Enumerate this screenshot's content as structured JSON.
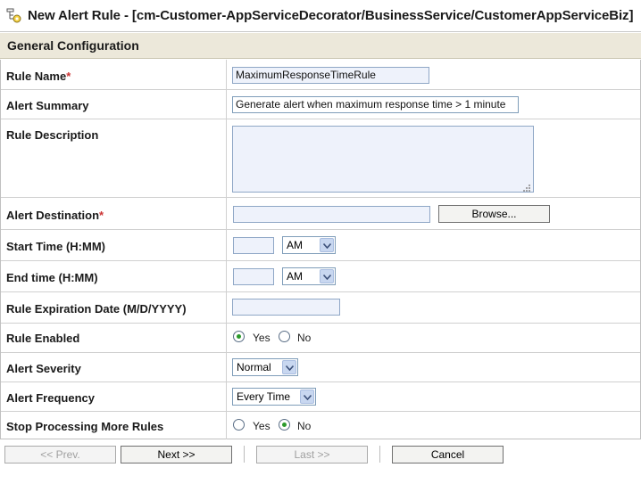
{
  "window": {
    "title": "New Alert Rule - [cm-Customer-AppServiceDecorator/BusinessService/CustomerAppServiceBiz]",
    "icon": "alert-rule-icon"
  },
  "section": {
    "title": "General Configuration"
  },
  "form": {
    "rule_name": {
      "label": "Rule Name",
      "required_mark": "*",
      "value": "MaximumResponseTimeRule"
    },
    "alert_summary": {
      "label": "Alert Summary",
      "value": "Generate alert when maximum response time > 1 minute"
    },
    "rule_description": {
      "label": "Rule Description",
      "value": ""
    },
    "alert_destination": {
      "label": "Alert Destination",
      "required_mark": "*",
      "value": "",
      "browse_label": "Browse..."
    },
    "start_time": {
      "label": "Start Time (H:MM)",
      "value": "",
      "ampm": "AM"
    },
    "end_time": {
      "label": "End time (H:MM)",
      "value": "",
      "ampm": "AM"
    },
    "expiration_date": {
      "label": "Rule Expiration Date (M/D/YYYY)",
      "value": ""
    },
    "rule_enabled": {
      "label": "Rule Enabled",
      "yes": "Yes",
      "no": "No",
      "selected": "Yes"
    },
    "alert_severity": {
      "label": "Alert Severity",
      "value": "Normal"
    },
    "alert_frequency": {
      "label": "Alert Frequency",
      "value": "Every Time"
    },
    "stop_processing": {
      "label": "Stop Processing More Rules",
      "yes": "Yes",
      "no": "No",
      "selected": "No"
    }
  },
  "footer": {
    "prev_label": "<< Prev.",
    "next_label": "Next >>",
    "last_label": "Last >>",
    "cancel_label": "Cancel"
  },
  "colors": {
    "section_bg": "#ece8da",
    "required": "#cc3333",
    "input_bg": "#eef2fb",
    "radio_checked": "#2b9a2b"
  }
}
